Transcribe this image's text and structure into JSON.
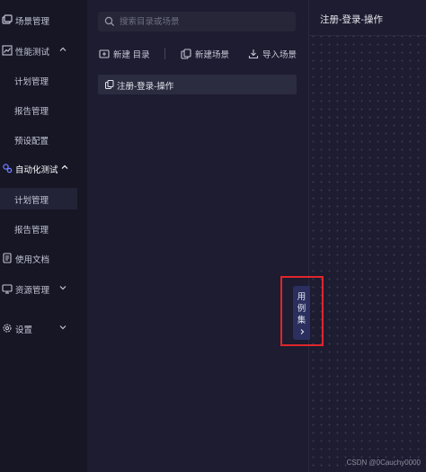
{
  "sidebar": {
    "items": [
      {
        "label": "场景管理",
        "icon": "scene-icon"
      },
      {
        "label": "性能测试",
        "icon": "chart-icon",
        "expanded": true,
        "children": [
          "计划管理",
          "报告管理",
          "预设配置"
        ]
      },
      {
        "label": "自动化测试",
        "icon": "automation-icon",
        "expanded": true,
        "children": [
          "计划管理",
          "报告管理"
        ]
      },
      {
        "label": "使用文档",
        "icon": "document-icon"
      },
      {
        "label": "资源管理",
        "icon": "monitor-icon"
      },
      {
        "label": "设置",
        "icon": "gear-icon"
      }
    ]
  },
  "middle": {
    "search": {
      "placeholder": "搜索目录或场景",
      "value": ""
    },
    "toolbar": {
      "new_dir": "新建 目录",
      "new_scene": "新建场景",
      "import_scene": "导入场景"
    },
    "tree": [
      {
        "label": "注册-登录-操作",
        "icon": "copy-icon"
      }
    ]
  },
  "right": {
    "title": "注册-登录-操作"
  },
  "case_tab": {
    "label": "用例集"
  },
  "footer": "CSDN @0Cauchy0000",
  "colors": {
    "sidebar_bg": "#161625",
    "panel_bg": "#1d1c30",
    "selected_bg": "#2c2c40",
    "tab_bg": "#2a2f5e",
    "highlight_border": "#e0262b"
  }
}
